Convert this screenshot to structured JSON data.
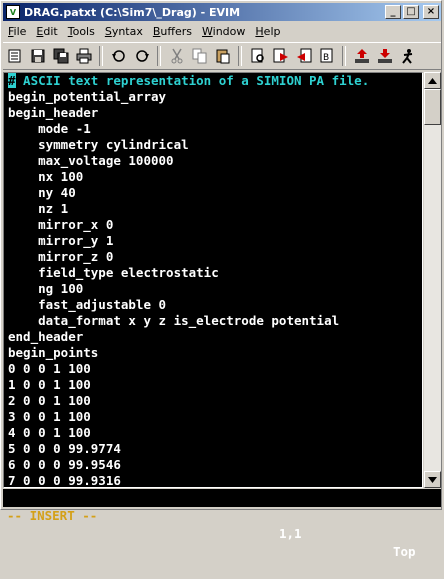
{
  "window": {
    "title": "DRAG.patxt (C:\\Sim7\\_Drag) - EVIM",
    "app_icon": "vim-icon",
    "controls": {
      "minimize": "_",
      "maximize": "□",
      "close": "×"
    }
  },
  "menu": [
    {
      "label": "File"
    },
    {
      "label": "Edit"
    },
    {
      "label": "Tools"
    },
    {
      "label": "Syntax"
    },
    {
      "label": "Buffers"
    },
    {
      "label": "Window"
    },
    {
      "label": "Help"
    }
  ],
  "toolbar": [
    "open-icon",
    "save-icon",
    "save-all-icon",
    "print-icon",
    "undo-icon",
    "redo-icon",
    "cut-icon",
    "copy-icon",
    "paste-icon",
    "find-icon",
    "find-next-icon",
    "find-prev-icon",
    "replace-icon",
    "load-session-icon",
    "save-session-icon",
    "run-script-icon"
  ],
  "editor": {
    "lines": [
      "# ASCII text representation of a SIMION PA file.",
      "begin_potential_array",
      "begin_header",
      "    mode -1",
      "    symmetry cylindrical",
      "    max_voltage 100000",
      "    nx 100",
      "    ny 40",
      "    nz 1",
      "    mirror_x 0",
      "    mirror_y 1",
      "    mirror_z 0",
      "    field_type electrostatic",
      "    ng 100",
      "    fast_adjustable 0",
      "    data_format x y z is_electrode potential",
      "end_header",
      "begin_points",
      "0 0 0 1 100",
      "1 0 0 1 100",
      "2 0 0 1 100",
      "3 0 0 1 100",
      "4 0 0 1 100",
      "5 0 0 0 99.9774",
      "6 0 0 0 99.9546",
      "7 0 0 0 99.9316"
    ],
    "colors": {
      "background": "#000000",
      "text": "#ffffff",
      "comment": "#2ed1d1"
    }
  },
  "status": {
    "mode": "-- INSERT --",
    "position": "1,1",
    "scroll": "Top"
  }
}
